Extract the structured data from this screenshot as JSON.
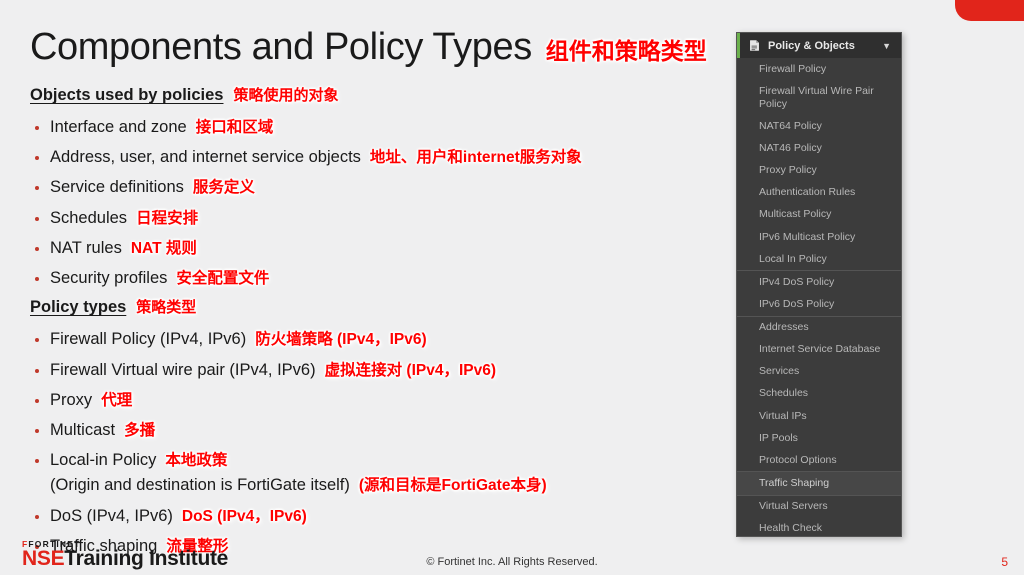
{
  "slide": {
    "title_en": "Components and Policy Types",
    "title_cn": "组件和策略类型",
    "sections": [
      {
        "heading_en": "Objects used by policies",
        "heading_cn": "策略使用的对象",
        "items": [
          {
            "en": "Interface and zone",
            "cn": "接口和区域"
          },
          {
            "en": "Address, user, and internet service objects",
            "cn": "地址、用户和internet服务对象"
          },
          {
            "en": "Service definitions",
            "cn": "服务定义"
          },
          {
            "en": "Schedules",
            "cn": "日程安排"
          },
          {
            "en": "NAT rules",
            "cn": "NAT 规则"
          },
          {
            "en": "Security profiles",
            "cn": "安全配置文件"
          }
        ]
      },
      {
        "heading_en": "Policy types",
        "heading_cn": "策略类型",
        "items": [
          {
            "en": "Firewall Policy (IPv4, IPv6)",
            "cn": "防火墙策略 (IPv4，IPv6)"
          },
          {
            "en": "Firewall Virtual wire pair (IPv4, IPv6)",
            "cn": "虚拟连接对 (IPv4，IPv6)"
          },
          {
            "en": "Proxy",
            "cn": "代理"
          },
          {
            "en": "Multicast",
            "cn": "多播"
          },
          {
            "en": "Local-in Policy",
            "cn": "本地政策",
            "sub_en": "(Origin and destination is FortiGate itself)",
            "sub_cn": "(源和目标是FortiGate本身)"
          },
          {
            "en": "DoS (IPv4, IPv6)",
            "cn": "DoS (IPv4，IPv6)"
          },
          {
            "en": "Traffic shaping",
            "cn": "流量整形"
          }
        ]
      }
    ]
  },
  "menu_panel": {
    "header_label": "Policy & Objects",
    "header_icon": "policy-document-icon",
    "caret_icon": "chevron-down-icon",
    "accent_color": "#6ab04c",
    "items": [
      {
        "label": "Firewall Policy",
        "active": false,
        "sep_top": false,
        "sep_bottom": false
      },
      {
        "label": "Firewall Virtual Wire Pair Policy",
        "active": false,
        "sep_top": false,
        "sep_bottom": false
      },
      {
        "label": "NAT64 Policy",
        "active": false,
        "sep_top": false,
        "sep_bottom": false
      },
      {
        "label": "NAT46 Policy",
        "active": false,
        "sep_top": false,
        "sep_bottom": false
      },
      {
        "label": "Proxy Policy",
        "active": false,
        "sep_top": false,
        "sep_bottom": false
      },
      {
        "label": "Authentication Rules",
        "active": false,
        "sep_top": false,
        "sep_bottom": false
      },
      {
        "label": "Multicast Policy",
        "active": false,
        "sep_top": false,
        "sep_bottom": false
      },
      {
        "label": "IPv6 Multicast Policy",
        "active": false,
        "sep_top": false,
        "sep_bottom": false
      },
      {
        "label": "Local In Policy",
        "active": false,
        "sep_top": false,
        "sep_bottom": true
      },
      {
        "label": "IPv4 DoS Policy",
        "active": false,
        "sep_top": false,
        "sep_bottom": false
      },
      {
        "label": "IPv6 DoS Policy",
        "active": false,
        "sep_top": false,
        "sep_bottom": true
      },
      {
        "label": "Addresses",
        "active": false,
        "sep_top": false,
        "sep_bottom": false
      },
      {
        "label": "Internet Service Database",
        "active": false,
        "sep_top": false,
        "sep_bottom": false
      },
      {
        "label": "Services",
        "active": false,
        "sep_top": false,
        "sep_bottom": false
      },
      {
        "label": "Schedules",
        "active": false,
        "sep_top": false,
        "sep_bottom": false
      },
      {
        "label": "Virtual IPs",
        "active": false,
        "sep_top": false,
        "sep_bottom": false
      },
      {
        "label": "IP Pools",
        "active": false,
        "sep_top": false,
        "sep_bottom": false
      },
      {
        "label": "Protocol Options",
        "active": false,
        "sep_top": false,
        "sep_bottom": true
      },
      {
        "label": "Traffic Shaping",
        "active": true,
        "sep_top": false,
        "sep_bottom": true
      },
      {
        "label": "Virtual Servers",
        "active": false,
        "sep_top": false,
        "sep_bottom": false
      },
      {
        "label": "Health Check",
        "active": false,
        "sep_top": false,
        "sep_bottom": false
      }
    ]
  },
  "footer": {
    "brand_fortinet": "FORTINET",
    "brand_nse": "NSE",
    "brand_training": "Training Institute",
    "copyright": "© Fortinet Inc. All Rights Reserved.",
    "page_number": "5"
  }
}
